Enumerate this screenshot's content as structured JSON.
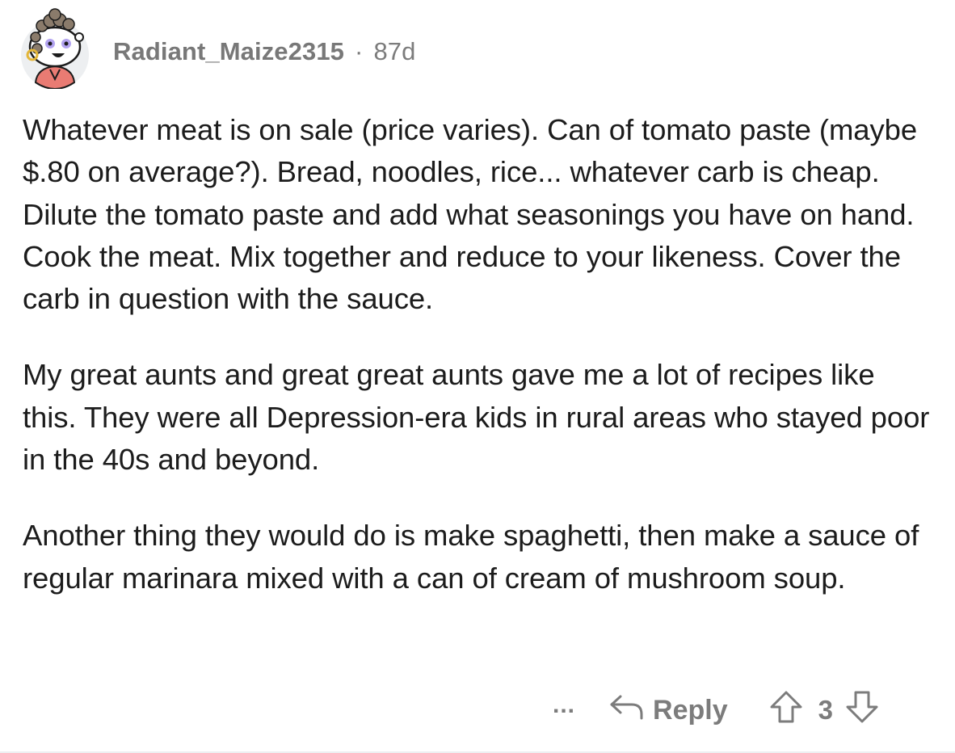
{
  "comment": {
    "author": "Radiant_Maize2315",
    "separator": "·",
    "age": "87d",
    "avatar_icon": "snoo-avatar-icon",
    "paragraphs": [
      "Whatever meat is on sale (price varies). Can of tomato paste (maybe $.80 on average?). Bread, noodles, rice... whatever carb is cheap. Dilute the tomato paste and add what seasonings you have on hand. Cook the meat. Mix together and reduce to your likeness. Cover the carb in question with the sauce.",
      "My great aunts and great great aunts gave me a lot of recipes like this. They were all Depression-era kids in rural areas who stayed poor in the 40s and beyond.",
      "Another thing they would do is make spaghetti, then make a sauce of regular marinara mixed with a can of cream of mushroom soup."
    ]
  },
  "actions": {
    "more_label": "...",
    "reply_label": "Reply",
    "vote_count": "3",
    "icons": {
      "more": "more-options-icon",
      "reply": "reply-arrow-icon",
      "upvote": "upvote-arrow-icon",
      "downvote": "downvote-arrow-icon"
    }
  },
  "colors": {
    "text": "#1c1c1c",
    "meta": "#7c7c7c",
    "background": "#ffffff"
  }
}
